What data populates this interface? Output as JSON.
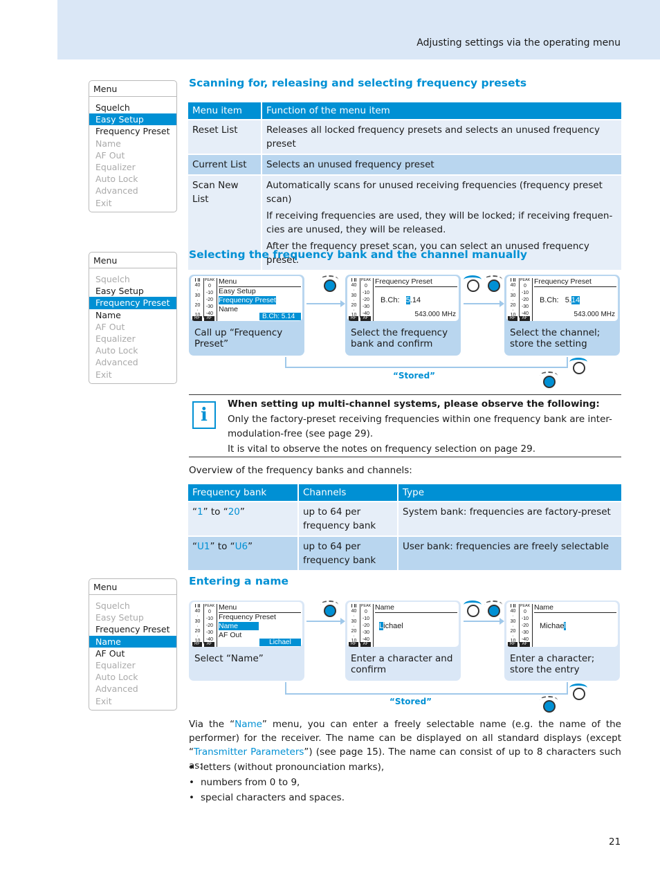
{
  "header": {
    "section_title": "Adjusting settings via the operating menu"
  },
  "menus": [
    {
      "title": "Menu",
      "items": [
        {
          "label": "Squelch",
          "state": "active"
        },
        {
          "label": "Easy Setup",
          "state": "selected"
        },
        {
          "label": "Frequency Preset",
          "state": "active"
        },
        {
          "label": "Name",
          "state": "inactive"
        },
        {
          "label": "AF Out",
          "state": "inactive"
        },
        {
          "label": "Equalizer",
          "state": "inactive"
        },
        {
          "label": "Auto Lock",
          "state": "inactive"
        },
        {
          "label": "Advanced",
          "state": "inactive"
        },
        {
          "label": "Exit",
          "state": "inactive"
        }
      ]
    },
    {
      "title": "Menu",
      "items": [
        {
          "label": "Squelch",
          "state": "inactive"
        },
        {
          "label": "Easy Setup",
          "state": "active"
        },
        {
          "label": "Frequency Preset",
          "state": "selected"
        },
        {
          "label": "Name",
          "state": "active"
        },
        {
          "label": "AF Out",
          "state": "inactive"
        },
        {
          "label": "Equalizer",
          "state": "inactive"
        },
        {
          "label": "Auto Lock",
          "state": "inactive"
        },
        {
          "label": "Advanced",
          "state": "inactive"
        },
        {
          "label": "Exit",
          "state": "inactive"
        }
      ]
    },
    {
      "title": "Menu",
      "items": [
        {
          "label": "Squelch",
          "state": "inactive"
        },
        {
          "label": "Easy Setup",
          "state": "inactive"
        },
        {
          "label": "Frequency Preset",
          "state": "active"
        },
        {
          "label": "Name",
          "state": "selected"
        },
        {
          "label": "AF Out",
          "state": "active"
        },
        {
          "label": "Equalizer",
          "state": "inactive"
        },
        {
          "label": "Auto Lock",
          "state": "inactive"
        },
        {
          "label": "Advanced",
          "state": "inactive"
        },
        {
          "label": "Exit",
          "state": "inactive"
        }
      ]
    }
  ],
  "section1": {
    "heading": "Scanning for, releasing and selecting frequency presets",
    "table": {
      "headers": [
        "Menu item",
        "Function of the menu item"
      ],
      "rows": [
        {
          "item": "Reset List",
          "paras": [
            "Releases all locked frequency presets and selects an unused frequency preset"
          ]
        },
        {
          "item": "Current List",
          "paras": [
            "Selects an unused frequency preset"
          ]
        },
        {
          "item": "Scan New List",
          "paras": [
            "Automatically scans for unused receiving frequencies (frequency preset scan)",
            "If receiving frequencies are used, they will be locked; if receiving frequen-cies are unused, they will be released.",
            "After the frequency preset scan, you can select an unused frequency preset."
          ]
        }
      ]
    }
  },
  "section2": {
    "heading": "Selecting the frequency bank and the channel manually",
    "meter": {
      "col1_header": "I II",
      "col1": [
        "40",
        "30",
        "20",
        "10"
      ],
      "col2_header": "PEAK",
      "col2": [
        "0",
        "-10",
        "-20",
        "-30",
        "-40"
      ],
      "rf_label": "RF",
      "af_label": "AF"
    },
    "steps": [
      {
        "screen_title": "Menu",
        "lines": [
          "Easy Setup",
          "Frequency Preset",
          "Name"
        ],
        "bar": "B.Ch:    5.14",
        "caption": "Call up “Frequency Preset”"
      },
      {
        "screen_title": "Frequency Preset",
        "bch_label": "B.Ch:",
        "bch_hl": "5",
        "bch_rest": ".14",
        "freq": "543.000 MHz",
        "caption": "Select the frequency bank and confirm"
      },
      {
        "screen_title": "Frequency Preset",
        "bch_label": "B.Ch:",
        "bch_pre": "5.",
        "bch_hl": "14",
        "freq": "543.000 MHz",
        "caption": "Select the channel; store the setting"
      }
    ],
    "stored_label": "“Stored”"
  },
  "info": {
    "title": "When setting up multi-channel systems, please observe the following:",
    "lines": [
      "Only the factory-preset receiving frequencies within one frequency bank are inter-modulation-free (see page 29).",
      "It is vital to observe the notes on frequency selection on page 29."
    ]
  },
  "overview": {
    "intro": "Overview of the frequency banks and channels:",
    "headers": [
      "Frequency bank",
      "Channels",
      "Type"
    ],
    "rows": [
      {
        "bank_a": "1",
        "bank_mid": "” to “",
        "bank_b": "20",
        "channels": "up to 64 per frequency bank",
        "type": "System bank: frequencies are factory-preset"
      },
      {
        "bank_a": "U1",
        "bank_mid": "” to “",
        "bank_b": "U6",
        "channels": "up to 64 per frequency bank",
        "type": "User bank: frequencies are freely selectable"
      }
    ]
  },
  "section3": {
    "heading": "Entering a name",
    "steps": [
      {
        "screen_title": "Menu",
        "lines": [
          "Frequency Preset",
          "Name",
          "AF Out"
        ],
        "bar": "Lichael",
        "caption": "Select “Name”"
      },
      {
        "screen_title": "Name",
        "hl": "L",
        "rest": "ichael",
        "caption": "Enter a character and confirm"
      },
      {
        "screen_title": "Name",
        "pre": "Michae",
        "hl": "l",
        "caption": "Enter a character; store the entry"
      }
    ],
    "stored_label": "“Stored”",
    "para_pre": "Via the “",
    "para_link1": "Name",
    "para_mid": "” menu, you can enter a freely selectable name (e.g. the name of the performer) for the receiver. The name can be displayed on all standard displays (except “",
    "para_link2": "Transmitter Parameters",
    "para_post": "”) (see page 15). The name can consist of up to 8 characters such as:",
    "bullets": [
      "letters (without pronounciation marks),",
      "numbers from 0 to 9,",
      "special characters and spaces."
    ]
  },
  "page_number": "21",
  "colors": {
    "accent": "#0090d4",
    "band": "#dae7f6",
    "row_light": "#e6eef8",
    "row_dark": "#b9d6ef"
  }
}
